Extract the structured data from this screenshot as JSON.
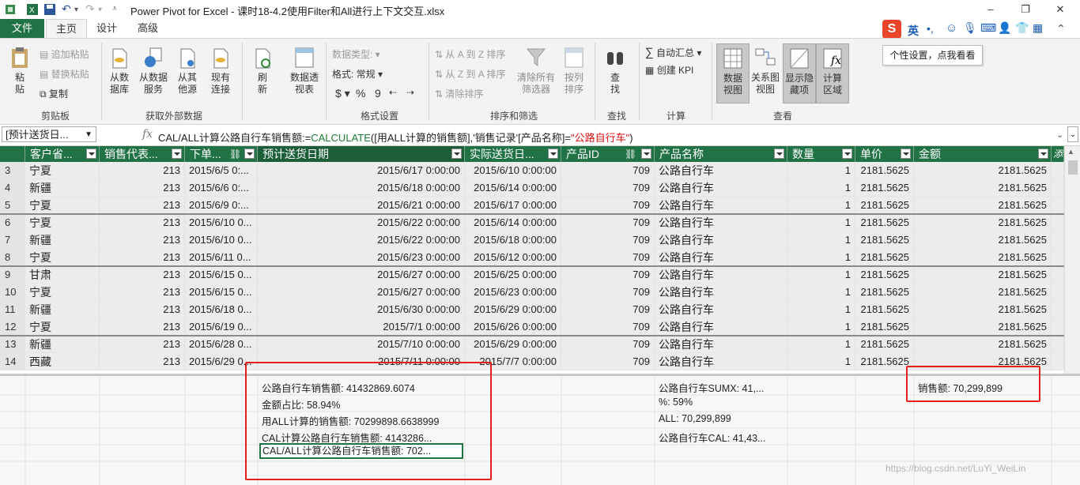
{
  "window": {
    "title": "Power Pivot for Excel - 课时18-4.2使用Filter和All进行上下文交互.xlsx",
    "buttons": [
      "–",
      "❐",
      "✕"
    ]
  },
  "tabs": [
    "文件",
    "主页",
    "设计",
    "高级"
  ],
  "ribbon": {
    "clipboard": {
      "group": "剪贴板",
      "paste": "粘贴",
      "append_paste": "追加粘贴",
      "replace_paste": "替换粘贴",
      "copy": "复制"
    },
    "external": {
      "group": "获取外部数据",
      "from_db": "从数据库",
      "from_service": "从数据服务",
      "from_other": "从其他源",
      "existing": "现有连接"
    },
    "refresh": {
      "label": "刷新"
    },
    "pivot": {
      "label": "数据透视表"
    },
    "format": {
      "group": "格式设置",
      "data_type": "数据类型:",
      "format": "格式: 常规",
      "currency": "$",
      "percent": "%",
      "comma": "9"
    },
    "sort": {
      "group": "排序和筛选",
      "az": "从 A 到 Z 排序",
      "za": "从 Z 到 A 排序",
      "clear_sort": "清除排序",
      "clear_filters": "清除所有筛选器",
      "sort_by_col": "按列排序"
    },
    "find": {
      "group": "查找",
      "label": "查找"
    },
    "calc": {
      "group": "计算",
      "autosum": "自动汇总",
      "create_kpi": "创建 KPI"
    },
    "view": {
      "group": "查看",
      "data_view": "数据视图",
      "diagram_view": "关系图视图",
      "show_hidden": "显示隐藏项",
      "calc_area": "计算区域"
    }
  },
  "tooltip": "个性设置，点我看看",
  "ime": {
    "logo": "S",
    "mode": "英"
  },
  "formula_bar": {
    "name_box": "[预计送货日...",
    "fx": "fx",
    "prefix": "CAL/ALL计算公路自行车销售额:=",
    "func": "CALCULATE",
    "middle": "([用ALL计算的销售额],'销售记录'[产品名称]=",
    "literal": "\"公路自行车\"",
    "suffix": ")"
  },
  "columns": [
    "客户省...",
    "销售代表...",
    "下单...",
    "预计送货日期",
    "实际送货日...",
    "产品ID",
    "产品名称",
    "数量",
    "单价",
    "金额",
    "添"
  ],
  "rows": [
    [
      "3",
      "宁夏",
      "213",
      "2015/6/5 0:...",
      "2015/6/17 0:00:00",
      "2015/6/10 0:00:00",
      "709",
      "公路自行车",
      "1",
      "2181.5625",
      "2181.5625"
    ],
    [
      "4",
      "新疆",
      "213",
      "2015/6/6 0:...",
      "2015/6/18 0:00:00",
      "2015/6/14 0:00:00",
      "709",
      "公路自行车",
      "1",
      "2181.5625",
      "2181.5625"
    ],
    [
      "5",
      "宁夏",
      "213",
      "2015/6/9 0:...",
      "2015/6/21 0:00:00",
      "2015/6/17 0:00:00",
      "709",
      "公路自行车",
      "1",
      "2181.5625",
      "2181.5625"
    ],
    [
      "6",
      "宁夏",
      "213",
      "2015/6/10 0...",
      "2015/6/22 0:00:00",
      "2015/6/14 0:00:00",
      "709",
      "公路自行车",
      "1",
      "2181.5625",
      "2181.5625"
    ],
    [
      "7",
      "新疆",
      "213",
      "2015/6/10 0...",
      "2015/6/22 0:00:00",
      "2015/6/18 0:00:00",
      "709",
      "公路自行车",
      "1",
      "2181.5625",
      "2181.5625"
    ],
    [
      "8",
      "宁夏",
      "213",
      "2015/6/11 0...",
      "2015/6/23 0:00:00",
      "2015/6/12 0:00:00",
      "709",
      "公路自行车",
      "1",
      "2181.5625",
      "2181.5625"
    ],
    [
      "9",
      "甘肃",
      "213",
      "2015/6/15 0...",
      "2015/6/27 0:00:00",
      "2015/6/25 0:00:00",
      "709",
      "公路自行车",
      "1",
      "2181.5625",
      "2181.5625"
    ],
    [
      "10",
      "宁夏",
      "213",
      "2015/6/15 0...",
      "2015/6/27 0:00:00",
      "2015/6/23 0:00:00",
      "709",
      "公路自行车",
      "1",
      "2181.5625",
      "2181.5625"
    ],
    [
      "11",
      "新疆",
      "213",
      "2015/6/18 0...",
      "2015/6/30 0:00:00",
      "2015/6/29 0:00:00",
      "709",
      "公路自行车",
      "1",
      "2181.5625",
      "2181.5625"
    ],
    [
      "12",
      "宁夏",
      "213",
      "2015/6/19 0...",
      "2015/7/1 0:00:00",
      "2015/6/26 0:00:00",
      "709",
      "公路自行车",
      "1",
      "2181.5625",
      "2181.5625"
    ],
    [
      "13",
      "新疆",
      "213",
      "2015/6/28 0...",
      "2015/7/10 0:00:00",
      "2015/6/29 0:00:00",
      "709",
      "公路自行车",
      "1",
      "2181.5625",
      "2181.5625"
    ],
    [
      "14",
      "西藏",
      "213",
      "2015/6/29 0...",
      "2015/7/11 0:00:00",
      "2015/7/7 0:00:00",
      "709",
      "公路自行车",
      "1",
      "2181.5625",
      "2181.5625"
    ]
  ],
  "calc_area": {
    "col_a": [
      "公路自行车销售额: 41432869.6074",
      "金额占比: 58.94%",
      "用ALL计算的销售额: 70299898.6638999",
      "CAL计算公路自行车销售额: 4143286...",
      "CAL/ALL计算公路自行车销售额: 702..."
    ],
    "col_b": [
      "公路自行车SUMX: 41,...",
      "%: 59%",
      "ALL: 70,299,899",
      "公路自行车CAL: 41,43..."
    ],
    "col_c": [
      "销售额: 70,299,899"
    ]
  },
  "watermark": "https://blog.csdn.net/LuYi_WeiLin",
  "colors": {
    "excel_green": "#217346",
    "red_annotation": "#e3201b",
    "formula_keyword": "#1e7d32",
    "formula_string": "#d11111"
  }
}
